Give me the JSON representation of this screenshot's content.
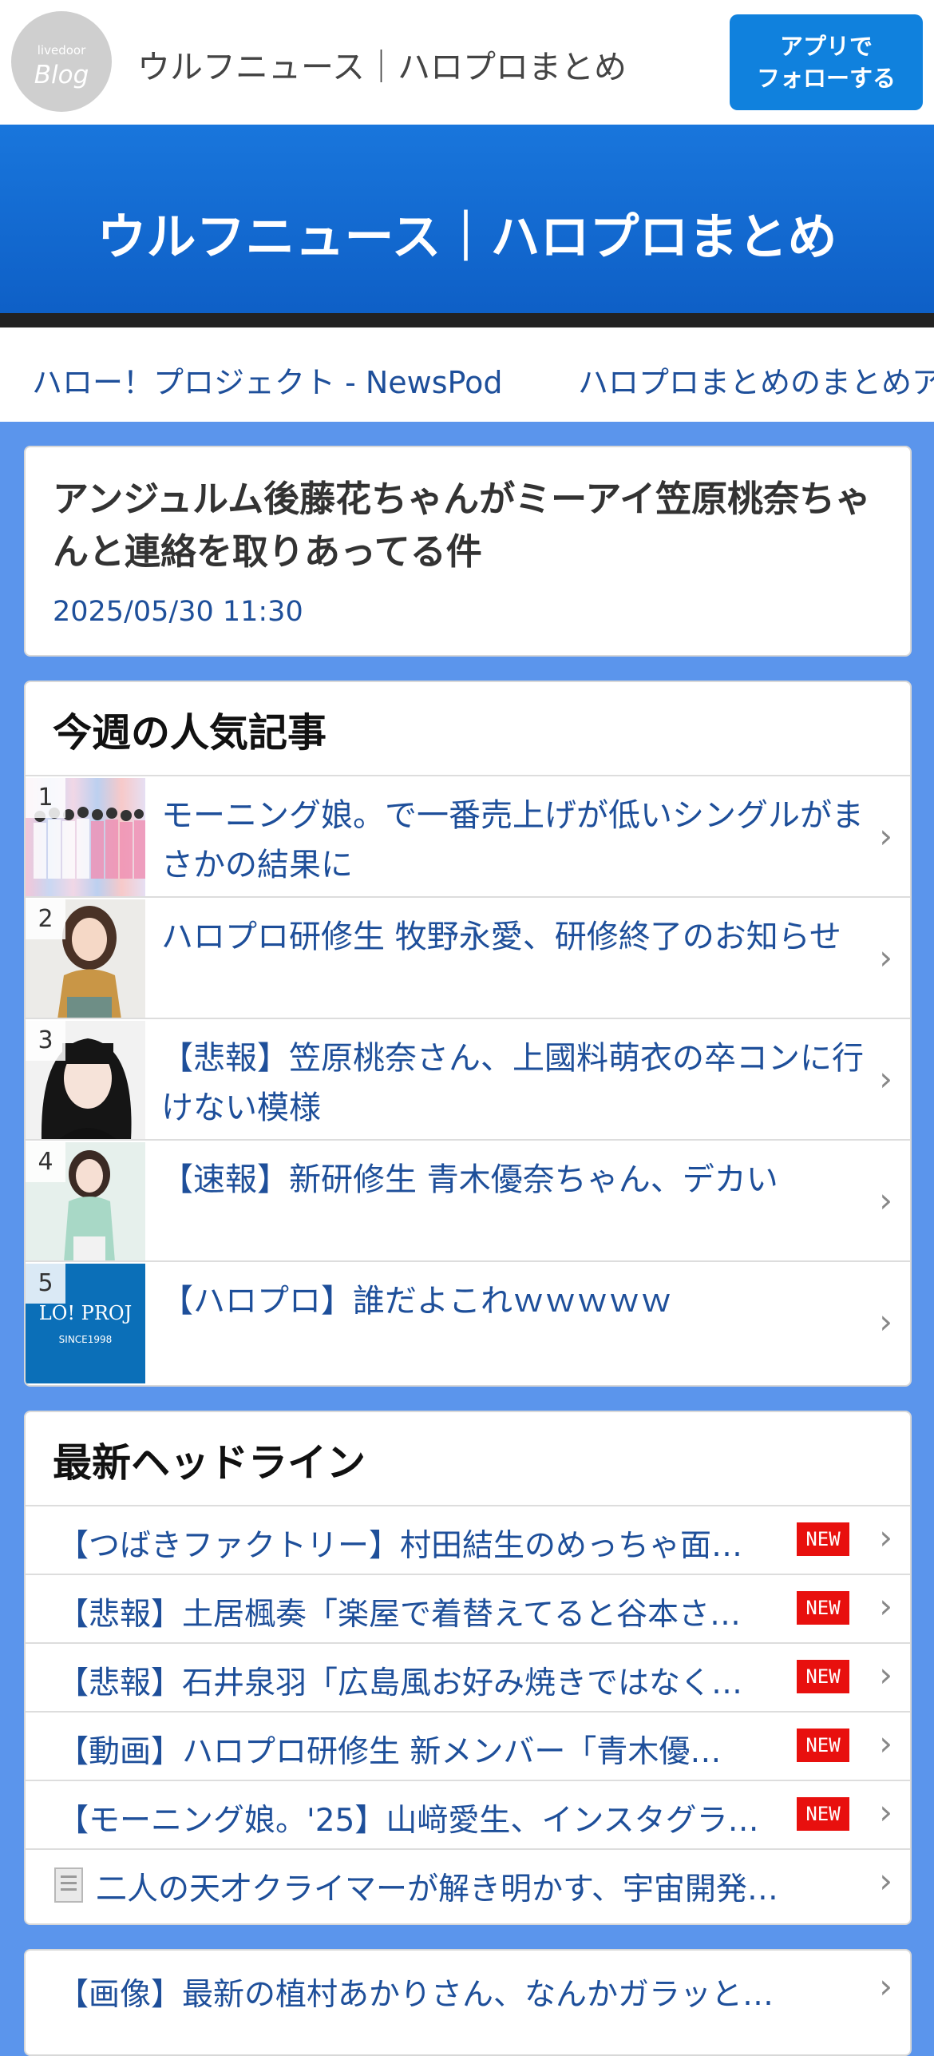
{
  "topbar": {
    "logo_small": "livedoor",
    "logo_big": "Blog",
    "site_title": "ウルフニュース｜ハロプロまとめ",
    "follow_line1": "アプリで",
    "follow_line2": "フォローする"
  },
  "banner": {
    "title": "ウルフニュース｜ハロプロまとめ"
  },
  "links": [
    "ハロー！プロジェクト - NewsPod",
    "ハロプロまとめのまとめア"
  ],
  "article": {
    "title": "アンジュルム後藤花ちゃんがミーアイ笠原桃奈ちゃんと連絡を取りあってる件",
    "date": "2025/05/30 11:30"
  },
  "popular": {
    "heading": "今週の人気記事",
    "items": [
      {
        "rank": "1",
        "title": "モーニング娘。で一番売上げが低いシングルがまさかの結果に"
      },
      {
        "rank": "2",
        "title": "ハロプロ研修生 牧野永愛、研修終了のお知らせ"
      },
      {
        "rank": "3",
        "title": "【悲報】笠原桃奈さん、上國料萌衣の卒コンに行けない模様"
      },
      {
        "rank": "4",
        "title": "【速報】新研修生 青木優奈ちゃん、デカい"
      },
      {
        "rank": "5",
        "title": "【ハロプロ】誰だよこれｗｗｗｗｗ"
      }
    ],
    "thumb5_line1": "LO! PROJ",
    "thumb5_line2": "SINCE1998"
  },
  "headlines": {
    "heading": "最新ヘッドライン",
    "new_label": "NEW",
    "items": [
      {
        "text": "【つばきファクトリー】村田結生のめっちゃ面…"
      },
      {
        "text": "【悲報】土居楓奏「楽屋で着替えてると谷本さ…"
      },
      {
        "text": "【悲報】石井泉羽「広島風お好み焼きではなく…"
      },
      {
        "text": "【動画】ハロプロ研修生 新メンバー「青木優…"
      },
      {
        "text": "【モーニング娘。'25】山﨑愛生、インスタグラ…"
      },
      {
        "text": "二人の天才クライマーが解き明かす、宇宙開発…"
      }
    ]
  },
  "extra": {
    "text": "【画像】最新の植村あかりさん、なんかガラッと…"
  },
  "icons": {
    "chevron": "chevron-right-icon",
    "document": "document-icon"
  },
  "colors": {
    "accent": "#1081dd",
    "page_bg": "#5b95ec",
    "link": "#1e4f9a",
    "new_badge": "#e8100e"
  }
}
